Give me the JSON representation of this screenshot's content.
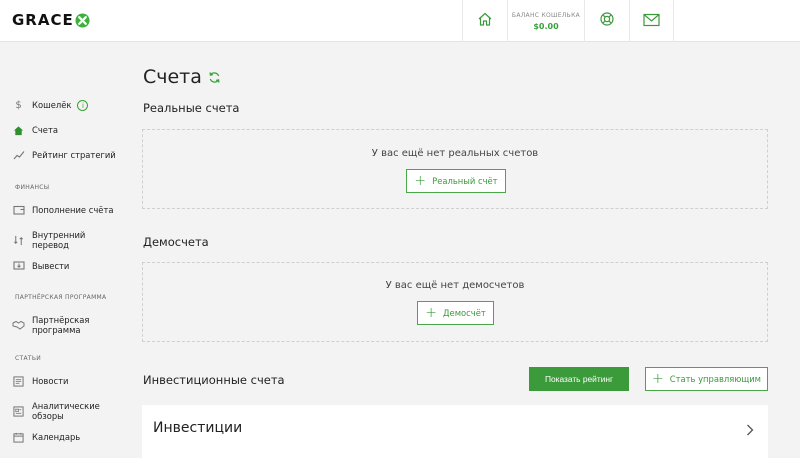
{
  "header": {
    "logo_text": "GRACE",
    "balance_label": "БАЛАНС КОШЕЛЬКА",
    "balance_value": "$0.00",
    "icons": [
      "home-icon",
      "lifebuoy-icon",
      "mail-icon"
    ]
  },
  "sidebar": {
    "wallet": "Кошелёк",
    "accounts": "Счета",
    "strategy_rating": "Рейтинг стратегий",
    "finance_section": "ФИНАНСЫ",
    "deposit": "Пополнение счёта",
    "internal_transfer": "Внутренний перевод",
    "withdraw": "Вывести",
    "partner_section": "ПАРТНЁРСКАЯ ПРОГРАММА",
    "partner_program": "Партнёрская программа",
    "articles_section": "СТАТЬИ",
    "news": "Новости",
    "analytics": "Аналитические обзоры",
    "calendar": "Календарь"
  },
  "main": {
    "title": "Счета",
    "real_section": "Реальные счета",
    "real_empty": "У вас ещё нет реальных счетов",
    "real_button": "Реальный счёт",
    "demo_section": "Демосчета",
    "demo_empty": "У вас ещё нет демосчетов",
    "demo_button": "Демосчёт",
    "invest_section": "Инвестиционные счета",
    "show_rating_button": "Показать рейтинг",
    "become_manager_button": "Стать управляющим",
    "invest_card_title": "Инвестиции"
  },
  "colors": {
    "accent": "#3b9b3b",
    "background": "#f3f3f3"
  }
}
